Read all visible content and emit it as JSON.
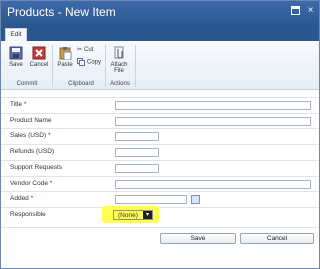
{
  "window": {
    "title": "Products - New Item",
    "close_glyph": "×"
  },
  "ribbon": {
    "tab": "Edit",
    "commit": {
      "group": "Commit",
      "save": "Save",
      "cancel": "Cancel"
    },
    "clipboard": {
      "group": "Clipboard",
      "paste": "Paste",
      "cut": "Cut",
      "copy": "Copy"
    },
    "actions": {
      "group": "Actions",
      "attach_line1": "Attach",
      "attach_line2": "File"
    }
  },
  "form": {
    "required_mark": "*",
    "fields": [
      {
        "label": "Title",
        "required": true
      },
      {
        "label": "Product Name",
        "required": false
      },
      {
        "label": "Sales (USD)",
        "required": true
      },
      {
        "label": "Refunds (USD)",
        "required": false
      },
      {
        "label": "Support Requests",
        "required": false
      },
      {
        "label": "Vendor Code",
        "required": true
      },
      {
        "label": "Added",
        "required": true
      },
      {
        "label": "Responsible",
        "required": false,
        "value": "(None)"
      }
    ]
  },
  "buttons": {
    "save": "Save",
    "cancel": "Cancel"
  },
  "colors": {
    "highlight": "#ffff4f",
    "titlebar": "#2b578f",
    "required": "#c00000"
  }
}
